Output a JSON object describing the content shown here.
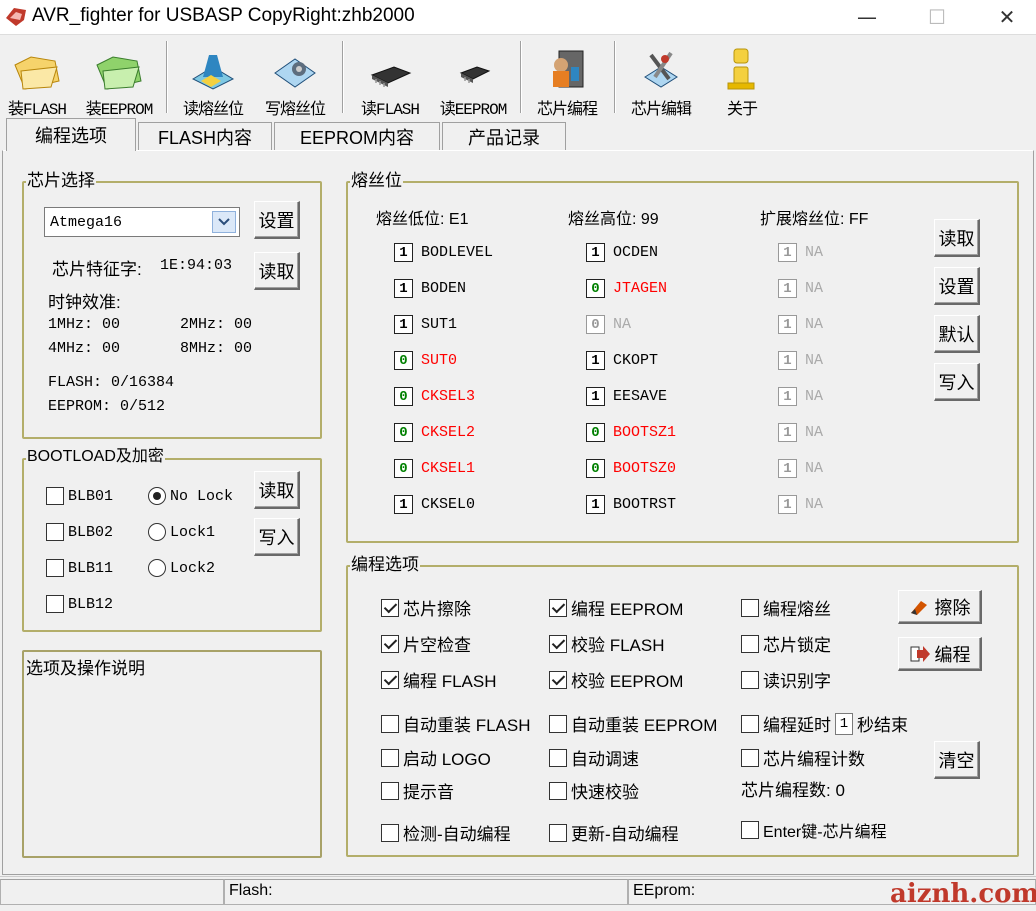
{
  "title": "AVR_fighter for USBASP CopyRight:zhb2000",
  "window": {
    "minimize": "—",
    "maximize": "☐",
    "close": "✕"
  },
  "toolbar": [
    {
      "label": "装FLASH",
      "icon": "folder-open-flash-icon"
    },
    {
      "label": "装EEPROM",
      "icon": "folder-open-eeprom-icon"
    },
    {
      "label": "读熔丝位",
      "icon": "read-fuse-icon"
    },
    {
      "label": "写熔丝位",
      "icon": "write-fuse-icon"
    },
    {
      "label": "读FLASH",
      "icon": "chip-read-flash-icon"
    },
    {
      "label": "读EEPROM",
      "icon": "chip-read-eeprom-icon"
    },
    {
      "label": "芯片编程",
      "icon": "program-chip-icon"
    },
    {
      "label": "芯片编辑",
      "icon": "edit-chip-icon"
    },
    {
      "label": "关于",
      "icon": "about-icon"
    }
  ],
  "tabs": [
    "编程选项",
    "FLASH内容",
    "EEPROM内容",
    "产品记录"
  ],
  "chip": {
    "group_label": "芯片选择",
    "selected": "Atmega16",
    "set_button": "设置",
    "read_button": "读取",
    "signature_label": "芯片特征字:",
    "signature_value": "1E:94:03",
    "calib_label": "时钟效准:",
    "calib": [
      "1MHz: 00",
      "2MHz: 00",
      "4MHz: 00",
      "8MHz: 00"
    ],
    "flash": "FLASH: 0/16384",
    "eeprom": "EEPROM: 0/512"
  },
  "boot": {
    "group_label": "BOOTLOAD及加密",
    "checks": [
      "BLB01",
      "BLB02",
      "BLB11",
      "BLB12"
    ],
    "radios": [
      "No Lock",
      "Lock1",
      "Lock2"
    ],
    "read_button": "读取",
    "write_button": "写入"
  },
  "notes": {
    "label": "选项及操作说明"
  },
  "fuse": {
    "group_label": "熔丝位",
    "low_header": "熔丝低位: E1",
    "high_header": "熔丝高位: 99",
    "ext_header": "扩展熔丝位: FF",
    "low": [
      {
        "v": "1",
        "n": "BODLEVEL",
        "s": "n"
      },
      {
        "v": "1",
        "n": "BODEN",
        "s": "n"
      },
      {
        "v": "1",
        "n": "SUT1",
        "s": "n"
      },
      {
        "v": "0",
        "n": "SUT0",
        "s": "r"
      },
      {
        "v": "0",
        "n": "CKSEL3",
        "s": "r"
      },
      {
        "v": "0",
        "n": "CKSEL2",
        "s": "r"
      },
      {
        "v": "0",
        "n": "CKSEL1",
        "s": "r"
      },
      {
        "v": "1",
        "n": "CKSEL0",
        "s": "n"
      }
    ],
    "high": [
      {
        "v": "1",
        "n": "OCDEN",
        "s": "n"
      },
      {
        "v": "0",
        "n": "JTAGEN",
        "s": "r"
      },
      {
        "v": "0",
        "n": "NA",
        "s": "d"
      },
      {
        "v": "1",
        "n": "CKOPT",
        "s": "n"
      },
      {
        "v": "1",
        "n": "EESAVE",
        "s": "n"
      },
      {
        "v": "0",
        "n": "BOOTSZ1",
        "s": "r"
      },
      {
        "v": "0",
        "n": "BOOTSZ0",
        "s": "r"
      },
      {
        "v": "1",
        "n": "BOOTRST",
        "s": "n"
      }
    ],
    "ext": [
      {
        "v": "1",
        "n": "NA",
        "s": "d"
      },
      {
        "v": "1",
        "n": "NA",
        "s": "d"
      },
      {
        "v": "1",
        "n": "NA",
        "s": "d"
      },
      {
        "v": "1",
        "n": "NA",
        "s": "d"
      },
      {
        "v": "1",
        "n": "NA",
        "s": "d"
      },
      {
        "v": "1",
        "n": "NA",
        "s": "d"
      },
      {
        "v": "1",
        "n": "NA",
        "s": "d"
      },
      {
        "v": "1",
        "n": "NA",
        "s": "d"
      }
    ],
    "buttons": [
      "读取",
      "设置",
      "默认",
      "写入"
    ]
  },
  "prog": {
    "group_label": "编程选项",
    "col1": [
      {
        "t": "芯片擦除",
        "c": true
      },
      {
        "t": "片空检查",
        "c": true
      },
      {
        "t": "编程 FLASH",
        "c": true
      }
    ],
    "col2": [
      {
        "t": "编程 EEPROM",
        "c": true
      },
      {
        "t": "校验 FLASH",
        "c": true
      },
      {
        "t": "校验 EEPROM",
        "c": true
      }
    ],
    "col3": [
      {
        "t": "编程熔丝",
        "c": false
      },
      {
        "t": "芯片锁定",
        "c": false
      },
      {
        "t": "读识别字",
        "c": false
      }
    ],
    "auto_reload_flash": "自动重装 FLASH",
    "auto_reload_eeprom": "自动重装 EEPROM",
    "delay_prefix": "编程延时",
    "delay_value": "1",
    "delay_suffix": "秒结束",
    "start_logo": "启动 LOGO",
    "auto_tune": "自动调速",
    "count_label": "芯片编程计数",
    "beep": "提示音",
    "fast_verify": "快速校验",
    "count_text": "芯片编程数: 0",
    "detect_auto": "检测-自动编程",
    "update_auto": "更新-自动编程",
    "enter_prog": "Enter键-芯片编程",
    "erase_button": "擦除",
    "program_button": "编程",
    "clear_button": "清空"
  },
  "status": {
    "flash": "Flash:",
    "eeprom": "EEprom:"
  },
  "watermark": "aiznh.com"
}
